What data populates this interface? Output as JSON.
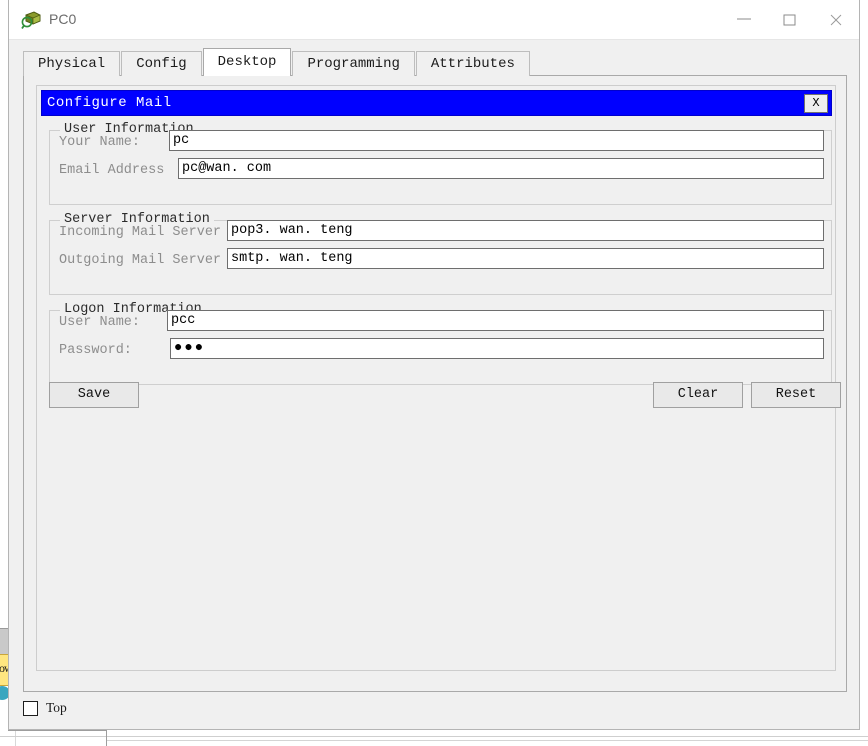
{
  "window": {
    "title": "PC0",
    "icon": "pc-device-icon",
    "controls": {
      "minimize": "minimize-icon",
      "maximize": "maximize-icon",
      "close": "close-icon"
    }
  },
  "tabs": [
    {
      "label": "Physical",
      "active": false
    },
    {
      "label": "Config",
      "active": false
    },
    {
      "label": "Desktop",
      "active": true
    },
    {
      "label": "Programming",
      "active": false
    },
    {
      "label": "Attributes",
      "active": false
    }
  ],
  "dialog": {
    "title": "Configure Mail",
    "close_label": "X",
    "title_bg_color": "#0000FF",
    "title_text_color": "#FFFFFF",
    "groups": [
      {
        "title": "User Information",
        "fields": [
          {
            "label": "Your Name:",
            "value": "pc",
            "type": "text"
          },
          {
            "label": "Email Address",
            "value": "pc@wan. com",
            "type": "text"
          }
        ]
      },
      {
        "title": "Server Information",
        "fields": [
          {
            "label": "Incoming Mail Server",
            "value": "pop3. wan. teng",
            "type": "text"
          },
          {
            "label": "Outgoing Mail Server",
            "value": "smtp. wan. teng",
            "type": "text"
          }
        ]
      },
      {
        "title": "Logon Information",
        "fields": [
          {
            "label": "User Name:",
            "value": "pcc",
            "type": "text"
          },
          {
            "label": "Password:",
            "value": "●●●",
            "type": "password"
          }
        ]
      }
    ],
    "buttons": {
      "save": "Save",
      "clear": "Clear",
      "reset": "Reset"
    }
  },
  "footer": {
    "top_checkbox_label": "Top",
    "top_checkbox_checked": false
  }
}
